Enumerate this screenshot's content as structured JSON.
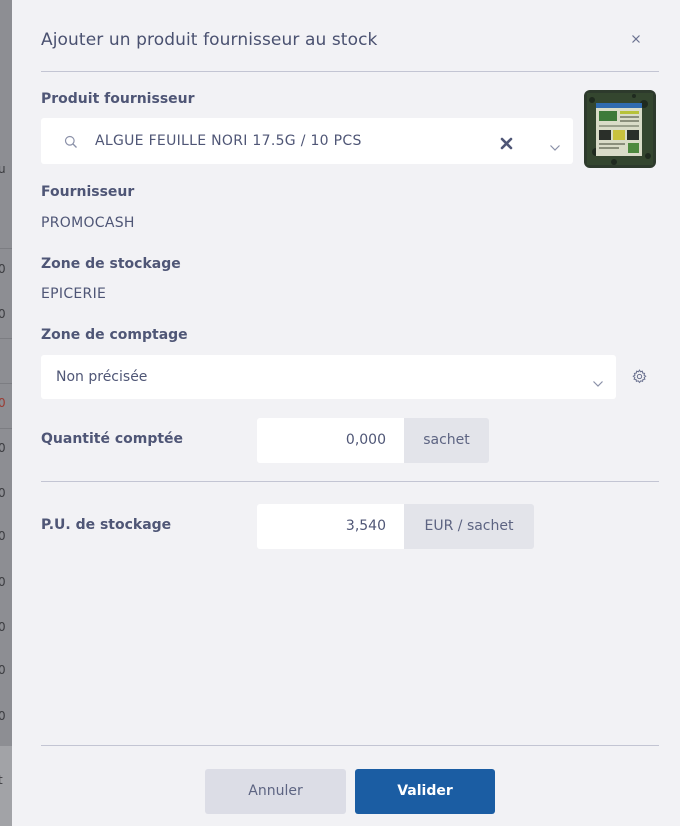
{
  "modal": {
    "title": "Ajouter un produit fournisseur au stock",
    "close_icon": "close-icon"
  },
  "supplier_product": {
    "label": "Produit fournisseur",
    "value": "ALGUE FEUILLE NORI 17.5G / 10 PCS",
    "search_icon": "search-icon",
    "clear_icon": "clear-x-icon",
    "chevron_icon": "chevron-down-icon",
    "thumbnail": "product-thumbnail"
  },
  "supplier": {
    "label": "Fournisseur",
    "value": "PROMOCASH"
  },
  "storage_zone": {
    "label": "Zone de stockage",
    "value": "EPICERIE"
  },
  "counting_zone": {
    "label": "Zone de comptage",
    "value": "Non précisée",
    "settings_icon": "gear-icon"
  },
  "quantity": {
    "label": "Quantité comptée",
    "value": "0,000",
    "unit": "sachet"
  },
  "unit_price": {
    "label": "P.U. de stockage",
    "value": "3,540",
    "unit": "EUR / sachet"
  },
  "actions": {
    "cancel_label": "Annuler",
    "submit_label": "Valider"
  },
  "colors": {
    "primary": "#1b5da3",
    "background": "#f2f2f5",
    "text": "#4f5676"
  }
}
